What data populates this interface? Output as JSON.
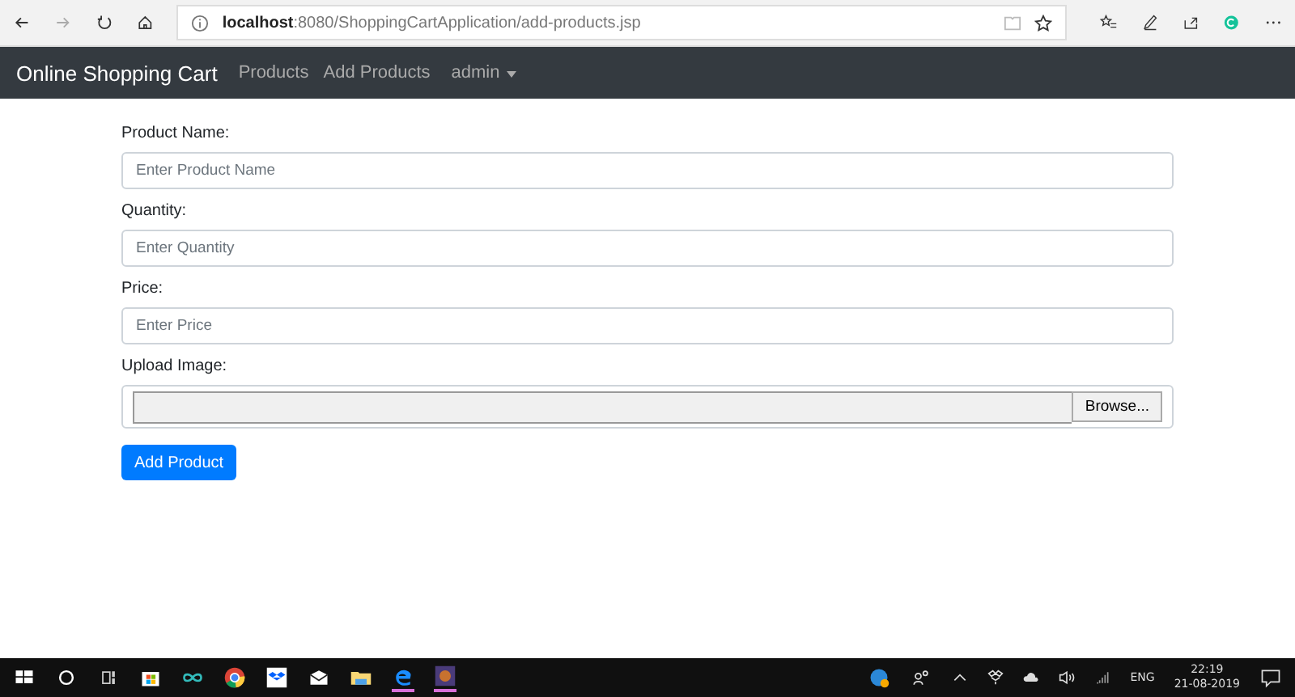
{
  "browser": {
    "address": "**localhost**:8080/ShoppingCartApplication/add-products.jsp"
  },
  "navbar": {
    "brand": "Online Shopping Cart",
    "links": [
      {
        "label": "Products"
      },
      {
        "label": "Add Products"
      }
    ],
    "dropdown": "admin"
  },
  "form": {
    "fields": [
      {
        "kind": "text",
        "label": "Product Name:",
        "placeholder": "Enter Product Name"
      },
      {
        "kind": "text",
        "label": "Quantity:",
        "placeholder": "Enter Quantity"
      },
      {
        "kind": "text",
        "label": "Price:",
        "placeholder": "Enter Price"
      },
      {
        "kind": "file",
        "label": "Upload Image:",
        "button": "Browse..."
      }
    ],
    "submit": "Add Product"
  },
  "taskbar": {
    "language": "ENG",
    "time": "22:19",
    "date": "21-08-2019"
  }
}
